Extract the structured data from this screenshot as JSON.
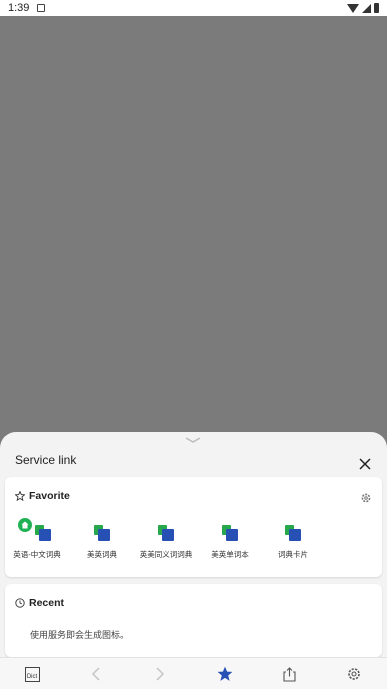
{
  "status_bar": {
    "time": "1:39"
  },
  "sheet": {
    "title": "Service link",
    "favorite": {
      "header": "Favorite",
      "items": [
        {
          "label": "英语-中文词典",
          "default": true
        },
        {
          "label": "美英词典",
          "default": false
        },
        {
          "label": "英美同义词词典",
          "default": false
        },
        {
          "label": "美英单词本",
          "default": false
        },
        {
          "label": "词典卡片",
          "default": false
        }
      ]
    },
    "recent": {
      "header": "Recent",
      "empty_text": "使用服务即会生成图标。"
    }
  },
  "bottom_nav": {
    "dict_label": "Dict"
  },
  "colors": {
    "accent_blue": "#2750b5",
    "accent_green": "#27a84a",
    "badge_green": "#20b155",
    "overlay_gray": "#7b7b7b"
  }
}
